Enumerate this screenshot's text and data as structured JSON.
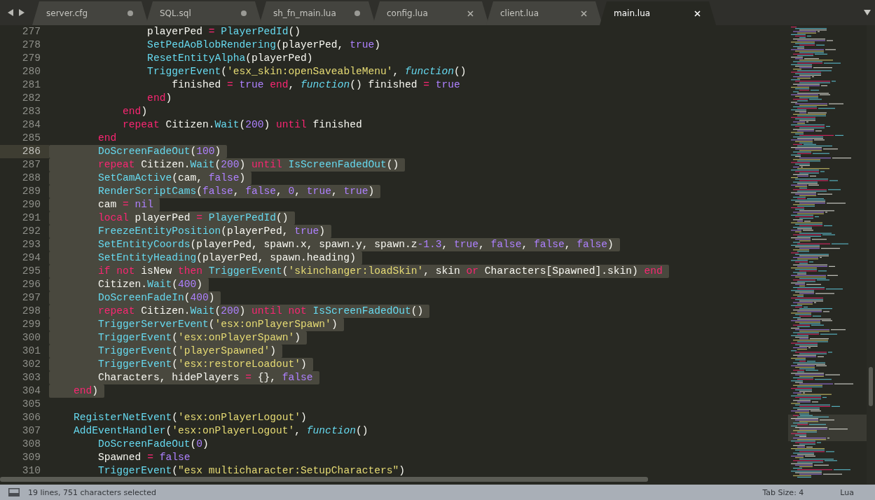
{
  "tabs": [
    {
      "label": "server.cfg",
      "selected": false,
      "modified": true
    },
    {
      "label": "SQL.sql",
      "selected": false,
      "modified": true
    },
    {
      "label": "sh_fn_main.lua",
      "selected": false,
      "modified": true
    },
    {
      "label": "config.lua",
      "selected": false,
      "modified": false
    },
    {
      "label": "client.lua",
      "selected": false,
      "modified": false
    },
    {
      "label": "main.lua",
      "selected": true,
      "modified": false
    }
  ],
  "lines": [
    {
      "number": "277",
      "selected": false,
      "current": false,
      "tokens": [
        {
          "kind": "plain",
          "text": "                playerPed "
        },
        {
          "kind": "keyword",
          "text": "="
        },
        {
          "kind": "function",
          "text": " PlayerPedId"
        },
        {
          "kind": "plain",
          "text": "()"
        }
      ]
    },
    {
      "number": "278",
      "selected": false,
      "current": false,
      "tokens": [
        {
          "kind": "function",
          "text": "                SetPedAoBlobRendering"
        },
        {
          "kind": "plain",
          "text": "(playerPed, "
        },
        {
          "kind": "constant",
          "text": "true"
        },
        {
          "kind": "plain",
          "text": ")"
        }
      ]
    },
    {
      "number": "279",
      "selected": false,
      "current": false,
      "tokens": [
        {
          "kind": "function",
          "text": "                ResetEntityAlpha"
        },
        {
          "kind": "plain",
          "text": "(playerPed)"
        }
      ]
    },
    {
      "number": "280",
      "selected": false,
      "current": false,
      "tokens": [
        {
          "kind": "function",
          "text": "                TriggerEvent"
        },
        {
          "kind": "plain",
          "text": "("
        },
        {
          "kind": "string",
          "text": "'esx_skin:openSaveableMenu'"
        },
        {
          "kind": "plain",
          "text": ","
        },
        {
          "kind": "storage",
          "text": " function"
        },
        {
          "kind": "plain",
          "text": "()"
        }
      ]
    },
    {
      "number": "281",
      "selected": false,
      "current": false,
      "tokens": [
        {
          "kind": "plain",
          "text": "                    finished "
        },
        {
          "kind": "keyword",
          "text": "="
        },
        {
          "kind": "constant",
          "text": " true"
        },
        {
          "kind": "keyword",
          "text": " end"
        },
        {
          "kind": "plain",
          "text": ","
        },
        {
          "kind": "storage",
          "text": " function"
        },
        {
          "kind": "plain",
          "text": "() finished "
        },
        {
          "kind": "keyword",
          "text": "="
        },
        {
          "kind": "constant",
          "text": " true"
        }
      ]
    },
    {
      "number": "282",
      "selected": false,
      "current": false,
      "tokens": [
        {
          "kind": "keyword",
          "text": "                end"
        },
        {
          "kind": "plain",
          "text": ")"
        }
      ]
    },
    {
      "number": "283",
      "selected": false,
      "current": false,
      "tokens": [
        {
          "kind": "keyword",
          "text": "            end"
        },
        {
          "kind": "plain",
          "text": ")"
        }
      ]
    },
    {
      "number": "284",
      "selected": false,
      "current": false,
      "tokens": [
        {
          "kind": "keyword",
          "text": "            repeat"
        },
        {
          "kind": "plain",
          "text": " Citizen."
        },
        {
          "kind": "function",
          "text": "Wait"
        },
        {
          "kind": "plain",
          "text": "("
        },
        {
          "kind": "constant",
          "text": "200"
        },
        {
          "kind": "plain",
          "text": ")"
        },
        {
          "kind": "keyword",
          "text": " until"
        },
        {
          "kind": "plain",
          "text": " finished"
        }
      ]
    },
    {
      "number": "285",
      "selected": false,
      "current": false,
      "tokens": [
        {
          "kind": "keyword",
          "text": "        end"
        }
      ]
    },
    {
      "number": "286",
      "selected": true,
      "current": true,
      "tokens": [
        {
          "kind": "function",
          "text": "        DoScreenFadeOut"
        },
        {
          "kind": "plain",
          "text": "("
        },
        {
          "kind": "constant",
          "text": "100"
        },
        {
          "kind": "plain",
          "text": ")"
        }
      ]
    },
    {
      "number": "287",
      "selected": true,
      "current": false,
      "tokens": [
        {
          "kind": "keyword",
          "text": "        repeat"
        },
        {
          "kind": "plain",
          "text": " Citizen."
        },
        {
          "kind": "function",
          "text": "Wait"
        },
        {
          "kind": "plain",
          "text": "("
        },
        {
          "kind": "constant",
          "text": "200"
        },
        {
          "kind": "plain",
          "text": ")"
        },
        {
          "kind": "keyword",
          "text": " until"
        },
        {
          "kind": "function",
          "text": " IsScreenFadedOut"
        },
        {
          "kind": "plain",
          "text": "()"
        }
      ]
    },
    {
      "number": "288",
      "selected": true,
      "current": false,
      "tokens": [
        {
          "kind": "function",
          "text": "        SetCamActive"
        },
        {
          "kind": "plain",
          "text": "(cam, "
        },
        {
          "kind": "constant",
          "text": "false"
        },
        {
          "kind": "plain",
          "text": ")"
        }
      ]
    },
    {
      "number": "289",
      "selected": true,
      "current": false,
      "tokens": [
        {
          "kind": "function",
          "text": "        RenderScriptCams"
        },
        {
          "kind": "plain",
          "text": "("
        },
        {
          "kind": "constant",
          "text": "false"
        },
        {
          "kind": "plain",
          "text": ","
        },
        {
          "kind": "constant",
          "text": " false"
        },
        {
          "kind": "plain",
          "text": ","
        },
        {
          "kind": "constant",
          "text": " 0"
        },
        {
          "kind": "plain",
          "text": ","
        },
        {
          "kind": "constant",
          "text": " true"
        },
        {
          "kind": "plain",
          "text": ","
        },
        {
          "kind": "constant",
          "text": " true"
        },
        {
          "kind": "plain",
          "text": ")"
        }
      ]
    },
    {
      "number": "290",
      "selected": true,
      "current": false,
      "tokens": [
        {
          "kind": "plain",
          "text": "        cam "
        },
        {
          "kind": "keyword",
          "text": "="
        },
        {
          "kind": "constant",
          "text": " nil"
        }
      ]
    },
    {
      "number": "291",
      "selected": true,
      "current": false,
      "tokens": [
        {
          "kind": "keyword",
          "text": "        local"
        },
        {
          "kind": "plain",
          "text": " playerPed "
        },
        {
          "kind": "keyword",
          "text": "="
        },
        {
          "kind": "function",
          "text": " PlayerPedId"
        },
        {
          "kind": "plain",
          "text": "()"
        }
      ]
    },
    {
      "number": "292",
      "selected": true,
      "current": false,
      "tokens": [
        {
          "kind": "function",
          "text": "        FreezeEntityPosition"
        },
        {
          "kind": "plain",
          "text": "(playerPed, "
        },
        {
          "kind": "constant",
          "text": "true"
        },
        {
          "kind": "plain",
          "text": ")"
        }
      ]
    },
    {
      "number": "293",
      "selected": true,
      "current": false,
      "tokens": [
        {
          "kind": "function",
          "text": "        SetEntityCoords"
        },
        {
          "kind": "plain",
          "text": "(playerPed, spawn.x, spawn.y, spawn.z"
        },
        {
          "kind": "constant",
          "text": "-1.3"
        },
        {
          "kind": "plain",
          "text": ","
        },
        {
          "kind": "constant",
          "text": " true"
        },
        {
          "kind": "plain",
          "text": ","
        },
        {
          "kind": "constant",
          "text": " false"
        },
        {
          "kind": "plain",
          "text": ","
        },
        {
          "kind": "constant",
          "text": " false"
        },
        {
          "kind": "plain",
          "text": ","
        },
        {
          "kind": "constant",
          "text": " false"
        },
        {
          "kind": "plain",
          "text": ")"
        }
      ]
    },
    {
      "number": "294",
      "selected": true,
      "current": false,
      "tokens": [
        {
          "kind": "function",
          "text": "        SetEntityHeading"
        },
        {
          "kind": "plain",
          "text": "(playerPed, spawn.heading)"
        }
      ]
    },
    {
      "number": "295",
      "selected": true,
      "current": false,
      "tokens": [
        {
          "kind": "keyword",
          "text": "        if"
        },
        {
          "kind": "keyword",
          "text": " not"
        },
        {
          "kind": "plain",
          "text": " isNew "
        },
        {
          "kind": "keyword",
          "text": "then"
        },
        {
          "kind": "function",
          "text": " TriggerEvent"
        },
        {
          "kind": "plain",
          "text": "("
        },
        {
          "kind": "string",
          "text": "'skinchanger:loadSkin'"
        },
        {
          "kind": "plain",
          "text": ", skin "
        },
        {
          "kind": "keyword",
          "text": "or"
        },
        {
          "kind": "plain",
          "text": " Characters[Spawned].skin)"
        },
        {
          "kind": "keyword",
          "text": " end"
        }
      ]
    },
    {
      "number": "296",
      "selected": true,
      "current": false,
      "tokens": [
        {
          "kind": "plain",
          "text": "        Citizen."
        },
        {
          "kind": "function",
          "text": "Wait"
        },
        {
          "kind": "plain",
          "text": "("
        },
        {
          "kind": "constant",
          "text": "400"
        },
        {
          "kind": "plain",
          "text": ")"
        }
      ]
    },
    {
      "number": "297",
      "selected": true,
      "current": false,
      "tokens": [
        {
          "kind": "function",
          "text": "        DoScreenFadeIn"
        },
        {
          "kind": "plain",
          "text": "("
        },
        {
          "kind": "constant",
          "text": "400"
        },
        {
          "kind": "plain",
          "text": ")"
        }
      ]
    },
    {
      "number": "298",
      "selected": true,
      "current": false,
      "tokens": [
        {
          "kind": "keyword",
          "text": "        repeat"
        },
        {
          "kind": "plain",
          "text": " Citizen."
        },
        {
          "kind": "function",
          "text": "Wait"
        },
        {
          "kind": "plain",
          "text": "("
        },
        {
          "kind": "constant",
          "text": "200"
        },
        {
          "kind": "plain",
          "text": ")"
        },
        {
          "kind": "keyword",
          "text": " until not"
        },
        {
          "kind": "function",
          "text": " IsScreenFadedOut"
        },
        {
          "kind": "plain",
          "text": "()"
        }
      ]
    },
    {
      "number": "299",
      "selected": true,
      "current": false,
      "tokens": [
        {
          "kind": "function",
          "text": "        TriggerServerEvent"
        },
        {
          "kind": "plain",
          "text": "("
        },
        {
          "kind": "string",
          "text": "'esx:onPlayerSpawn'"
        },
        {
          "kind": "plain",
          "text": ")"
        }
      ]
    },
    {
      "number": "300",
      "selected": true,
      "current": false,
      "tokens": [
        {
          "kind": "function",
          "text": "        TriggerEvent"
        },
        {
          "kind": "plain",
          "text": "("
        },
        {
          "kind": "string",
          "text": "'esx:onPlayerSpawn'"
        },
        {
          "kind": "plain",
          "text": ")"
        }
      ]
    },
    {
      "number": "301",
      "selected": true,
      "current": false,
      "tokens": [
        {
          "kind": "function",
          "text": "        TriggerEvent"
        },
        {
          "kind": "plain",
          "text": "("
        },
        {
          "kind": "string",
          "text": "'playerSpawned'"
        },
        {
          "kind": "plain",
          "text": ")"
        }
      ]
    },
    {
      "number": "302",
      "selected": true,
      "current": false,
      "tokens": [
        {
          "kind": "function",
          "text": "        TriggerEvent"
        },
        {
          "kind": "plain",
          "text": "("
        },
        {
          "kind": "string",
          "text": "'esx:restoreLoadout'"
        },
        {
          "kind": "plain",
          "text": ")"
        }
      ]
    },
    {
      "number": "303",
      "selected": true,
      "current": false,
      "tokens": [
        {
          "kind": "plain",
          "text": "        Characters, hidePlayers "
        },
        {
          "kind": "keyword",
          "text": "="
        },
        {
          "kind": "plain",
          "text": " {},"
        },
        {
          "kind": "constant",
          "text": " false"
        }
      ]
    },
    {
      "number": "304",
      "selected": true,
      "current": false,
      "tokens": [
        {
          "kind": "keyword",
          "text": "    end"
        },
        {
          "kind": "plain",
          "text": ")"
        }
      ]
    },
    {
      "number": "305",
      "current": false
    },
    {
      "number": "306",
      "selected": false,
      "current": false,
      "tokens": [
        {
          "kind": "function",
          "text": "    RegisterNetEvent"
        },
        {
          "kind": "plain",
          "text": "("
        },
        {
          "kind": "string",
          "text": "'esx:onPlayerLogout'"
        },
        {
          "kind": "plain",
          "text": ")"
        }
      ]
    },
    {
      "number": "307",
      "selected": false,
      "current": false,
      "tokens": [
        {
          "kind": "function",
          "text": "    AddEventHandler"
        },
        {
          "kind": "plain",
          "text": "("
        },
        {
          "kind": "string",
          "text": "'esx:onPlayerLogout'"
        },
        {
          "kind": "plain",
          "text": ","
        },
        {
          "kind": "storage",
          "text": " function"
        },
        {
          "kind": "plain",
          "text": "()"
        }
      ]
    },
    {
      "number": "308",
      "selected": false,
      "current": false,
      "tokens": [
        {
          "kind": "function",
          "text": "        DoScreenFadeOut"
        },
        {
          "kind": "plain",
          "text": "("
        },
        {
          "kind": "constant",
          "text": "0"
        },
        {
          "kind": "plain",
          "text": ")"
        }
      ]
    },
    {
      "number": "309",
      "selected": false,
      "current": false,
      "tokens": [
        {
          "kind": "plain",
          "text": "        Spawned "
        },
        {
          "kind": "keyword",
          "text": "="
        },
        {
          "kind": "constant",
          "text": " false"
        }
      ]
    },
    {
      "number": "310",
      "selected": false,
      "current": false,
      "tokens": [
        {
          "kind": "function",
          "text": "        TriggerEvent"
        },
        {
          "kind": "plain",
          "text": "("
        },
        {
          "kind": "string",
          "text": "\"esx multicharacter:SetupCharacters\""
        },
        {
          "kind": "plain",
          "text": ")"
        }
      ]
    }
  ],
  "status_bar": {
    "selection": "19 lines, 751 characters selected",
    "tab_size": "Tab Size: 4",
    "syntax": "Lua"
  }
}
